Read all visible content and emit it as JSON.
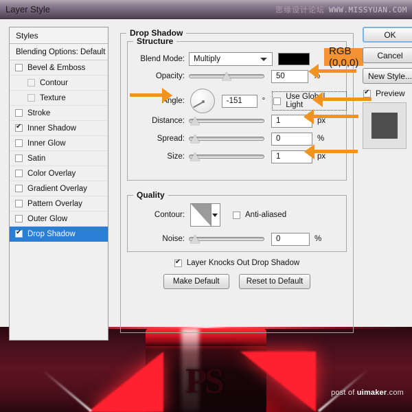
{
  "window": {
    "title": "Layer Style",
    "watermark_cn": "思缘设计论坛",
    "watermark_en": "WWW.MISSYUAN.COM"
  },
  "styles_panel": {
    "header": "Styles",
    "blending_options": "Blending Options: Default",
    "items": [
      {
        "label": "Bevel & Emboss",
        "checked": false,
        "indent": false,
        "selected": false,
        "enabled": true
      },
      {
        "label": "Contour",
        "checked": false,
        "indent": true,
        "selected": false,
        "enabled": false
      },
      {
        "label": "Texture",
        "checked": false,
        "indent": true,
        "selected": false,
        "enabled": false
      },
      {
        "label": "Stroke",
        "checked": false,
        "indent": false,
        "selected": false,
        "enabled": true
      },
      {
        "label": "Inner Shadow",
        "checked": true,
        "indent": false,
        "selected": false,
        "enabled": true
      },
      {
        "label": "Inner Glow",
        "checked": false,
        "indent": false,
        "selected": false,
        "enabled": true
      },
      {
        "label": "Satin",
        "checked": false,
        "indent": false,
        "selected": false,
        "enabled": true
      },
      {
        "label": "Color Overlay",
        "checked": false,
        "indent": false,
        "selected": false,
        "enabled": true
      },
      {
        "label": "Gradient Overlay",
        "checked": false,
        "indent": false,
        "selected": false,
        "enabled": true
      },
      {
        "label": "Pattern Overlay",
        "checked": false,
        "indent": false,
        "selected": false,
        "enabled": true
      },
      {
        "label": "Outer Glow",
        "checked": false,
        "indent": false,
        "selected": false,
        "enabled": true
      },
      {
        "label": "Drop Shadow",
        "checked": true,
        "indent": false,
        "selected": true,
        "enabled": true
      }
    ]
  },
  "drop_shadow": {
    "group_label": "Drop Shadow",
    "structure": {
      "label": "Structure",
      "blend_mode_label": "Blend Mode:",
      "blend_mode_value": "Multiply",
      "shadow_color": "#000000",
      "rgb_badge": "RGB (0,0,0)",
      "opacity_label": "Opacity:",
      "opacity_value": "50",
      "opacity_unit": "%",
      "opacity_percent": 50,
      "angle_label": "Angle:",
      "angle_value": "-151",
      "angle_unit": "°",
      "use_global_light": "Use Global Light",
      "use_global_light_checked": false,
      "distance_label": "Distance:",
      "distance_value": "1",
      "distance_unit": "px",
      "distance_percent": 2,
      "spread_label": "Spread:",
      "spread_value": "0",
      "spread_unit": "%",
      "spread_percent": 2,
      "size_label": "Size:",
      "size_value": "1",
      "size_unit": "px",
      "size_percent": 2
    },
    "quality": {
      "label": "Quality",
      "contour_label": "Contour:",
      "anti_aliased": "Anti-aliased",
      "anti_aliased_checked": false,
      "noise_label": "Noise:",
      "noise_value": "0",
      "noise_unit": "%",
      "noise_percent": 2
    },
    "knockout_label": "Layer Knocks Out Drop Shadow",
    "knockout_checked": true,
    "make_default": "Make Default",
    "reset_to_default": "Reset to Default"
  },
  "actions": {
    "ok": "OK",
    "cancel": "Cancel",
    "new_style": "New Style...",
    "preview": "Preview",
    "preview_checked": true
  },
  "annotations": {
    "accent_color": "#f0941f",
    "arrow_targets": [
      "opacity",
      "use-global-light",
      "distance",
      "size",
      "angle"
    ]
  },
  "photo": {
    "can_letter": "PS",
    "credit_prefix": "post of ",
    "credit_brand": "uimaker",
    "credit_suffix": ".com"
  }
}
